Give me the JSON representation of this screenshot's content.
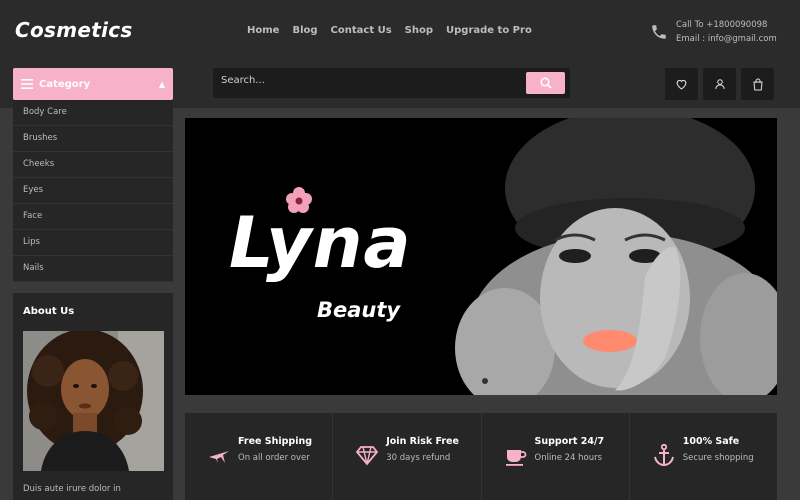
{
  "header": {
    "logo": "Cosmetics",
    "nav": [
      "Home",
      "Blog",
      "Contact Us",
      "Shop",
      "Upgrade to Pro"
    ],
    "contact": {
      "call": "Call To +1800090098",
      "email": "Email : info@gmail.com"
    }
  },
  "toolbar": {
    "category_label": "Category",
    "search_placeholder": "Search...",
    "icons": [
      "heart-icon",
      "user-icon",
      "shopping-bag-icon"
    ]
  },
  "sidebar": {
    "categories": [
      "Body Care",
      "Brushes",
      "Cheeks",
      "Eyes",
      "Face",
      "Lips",
      "Nails"
    ],
    "about": {
      "title": "About Us",
      "text": "Duis aute irure dolor in"
    }
  },
  "hero": {
    "title": "Lyna",
    "subtitle": "Beauty"
  },
  "features": [
    {
      "title": "Free Shipping",
      "sub": "On all order over",
      "icon": "plane-icon"
    },
    {
      "title": "Join Risk Free",
      "sub": "30 days refund",
      "icon": "diamond-icon"
    },
    {
      "title": "Support 24/7",
      "sub": "Online 24 hours",
      "icon": "cup-icon"
    },
    {
      "title": "100% Safe",
      "sub": "Secure shopping",
      "icon": "anchor-icon"
    }
  ],
  "colors": {
    "accent": "#f7b2c9",
    "background": "#2b2b2b",
    "panel": "#262626"
  }
}
